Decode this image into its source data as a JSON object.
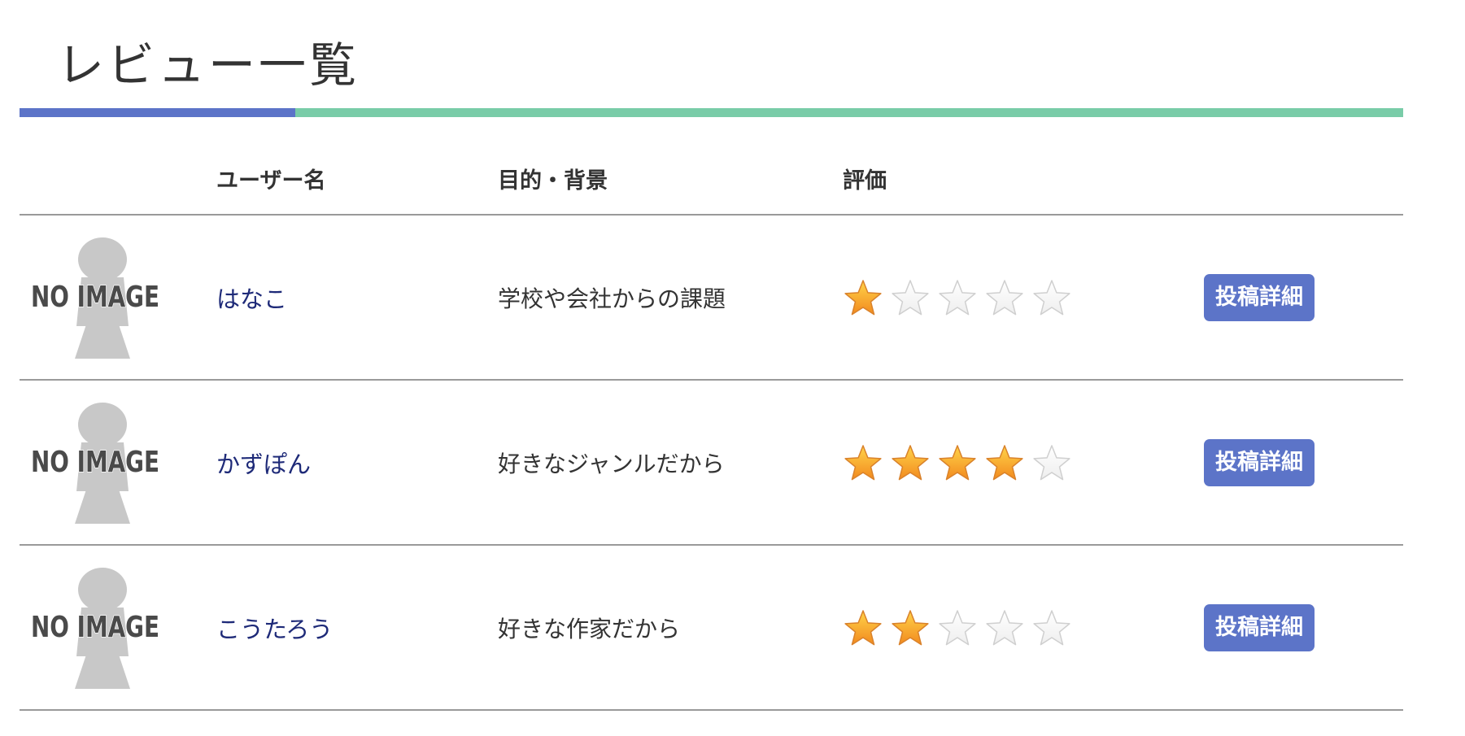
{
  "page": {
    "title": "レビュー一覧"
  },
  "table": {
    "headers": {
      "image": "",
      "user": "ユーザー名",
      "purpose": "目的・背景",
      "rating": "評価",
      "action": ""
    },
    "max_rating": 5,
    "rows": [
      {
        "avatar_text": "NO IMAGE",
        "user": "はなこ",
        "purpose": "学校や会社からの課題",
        "rating": 1,
        "button": "投稿詳細"
      },
      {
        "avatar_text": "NO IMAGE",
        "user": "かずぽん",
        "purpose": "好きなジャンルだから",
        "rating": 4,
        "button": "投稿詳細"
      },
      {
        "avatar_text": "NO IMAGE",
        "user": "こうたろう",
        "purpose": "好きな作家だから",
        "rating": 2,
        "button": "投稿詳細"
      }
    ]
  },
  "colors": {
    "brand_blue": "#5c74c8",
    "brand_green": "#79cca8",
    "link": "#1e2a78",
    "star_filled": "#f5a623",
    "star_empty": "#ffffff"
  },
  "icons": {
    "avatar": "no-image-icon",
    "star_filled": "star-filled-icon",
    "star_empty": "star-empty-icon"
  }
}
